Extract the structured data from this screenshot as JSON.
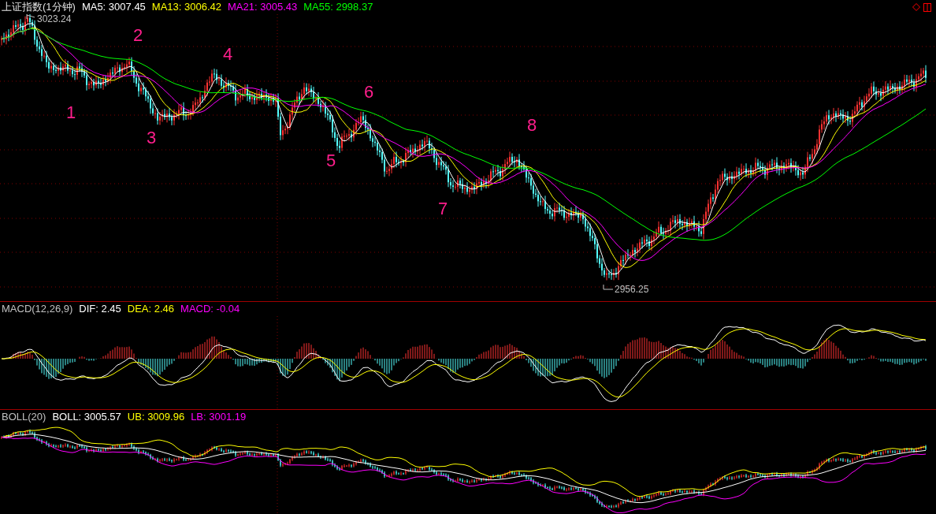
{
  "panels": [
    {
      "kind": "price",
      "title": "上证指数(1分钟)",
      "indicators": [
        {
          "label": "MA5: 3007.45",
          "color": "#ffffff"
        },
        {
          "label": "MA13: 3006.42",
          "color": "#ffff00"
        },
        {
          "label": "MA21: 3005.43",
          "color": "#ff00ff"
        },
        {
          "label": "MA55: 2998.37",
          "color": "#00ff00"
        }
      ],
      "high_label": "3023.24",
      "low_label": "2956.25",
      "wave_labels": [
        "1",
        "2",
        "3",
        "4",
        "5",
        "6",
        "7",
        "8"
      ]
    },
    {
      "kind": "macd",
      "title": "MACD(12,26,9)",
      "indicators": [
        {
          "label": "DIF: 2.45",
          "color": "#ffffff"
        },
        {
          "label": "DEA: 2.46",
          "color": "#ffff00"
        },
        {
          "label": "MACD: -0.04",
          "color": "#ff00ff"
        }
      ]
    },
    {
      "kind": "boll",
      "title": "BOLL(20)",
      "indicators": [
        {
          "label": "BOLL: 3005.57",
          "color": "#ffffff"
        },
        {
          "label": "UB: 3009.96",
          "color": "#ffff00"
        },
        {
          "label": "LB: 3001.19",
          "color": "#ff00ff"
        }
      ]
    }
  ]
}
